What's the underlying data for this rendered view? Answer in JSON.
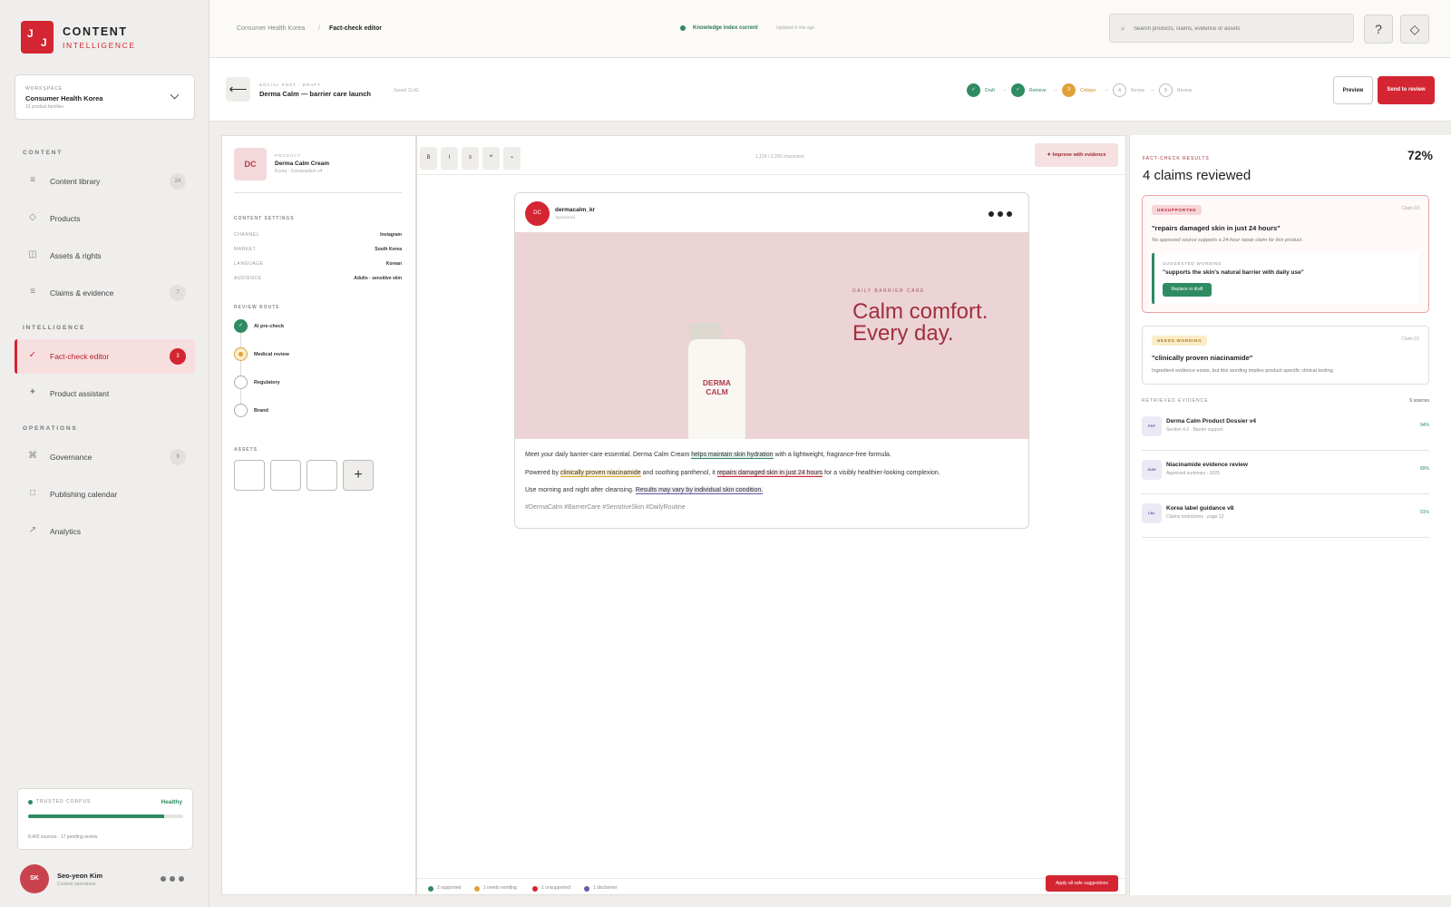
{
  "brand": {
    "mark_left": "J",
    "mark_right": "J",
    "title": "CONTENT",
    "subtitle": "INTELLIGENCE"
  },
  "workspace": {
    "label": "WORKSPACE",
    "name": "Consumer Health Korea",
    "sub": "12 product families"
  },
  "sidebar": {
    "sections": {
      "content": "CONTENT",
      "intelligence": "INTELLIGENCE",
      "operations": "OPERATIONS"
    },
    "items": [
      {
        "label": "Content library",
        "icon": "≡",
        "count": "24"
      },
      {
        "label": "Products",
        "icon": "◇",
        "count": ""
      },
      {
        "label": "Assets & rights",
        "icon": "◫",
        "count": ""
      },
      {
        "label": "Claims & evidence",
        "icon": "≡",
        "count": "7"
      },
      {
        "label": "Fact-check editor",
        "icon": "✓",
        "count": "3"
      },
      {
        "label": "Product assistant",
        "icon": "✦",
        "count": ""
      },
      {
        "label": "Governance",
        "icon": "⌘",
        "count": "9"
      },
      {
        "label": "Publishing calendar",
        "icon": "□",
        "count": ""
      },
      {
        "label": "Analytics",
        "icon": "↗",
        "count": ""
      }
    ]
  },
  "corpus": {
    "label": "TRUSTED CORPUS",
    "status": "Healthy",
    "health": 0.88,
    "sub": "8,402 sources · 17 pending review"
  },
  "user": {
    "initials": "SK",
    "name": "Seo-yeon Kim",
    "role": "Content operations"
  },
  "topbar": {
    "crumb_parent": "Consumer Health Korea",
    "crumb_sep": "/",
    "crumb_current": "Fact-check editor",
    "index_status": "Knowledge index current",
    "index_updated": "Updated 4 min ago",
    "search_placeholder": "Search products, claims, evidence or assets",
    "help_glyph": "?",
    "settings_glyph": "◇"
  },
  "doc": {
    "back_glyph": "⟵",
    "label": "SOCIAL POST · DRAFT",
    "title": "Derma Calm — barrier care launch",
    "saved": "Saved 11:42",
    "steps": [
      {
        "mark": "✓",
        "label": "Draft",
        "state": "done"
      },
      {
        "mark": "✓",
        "label": "Retrieve",
        "state": "done"
      },
      {
        "mark": "3",
        "label": "Critique",
        "state": "current"
      },
      {
        "mark": "4",
        "label": "Revise",
        "state": "todo"
      },
      {
        "mark": "5",
        "label": "Review",
        "state": "todo"
      }
    ],
    "step_arrow": "→",
    "preview": "Preview",
    "send": "Send to review"
  },
  "product": {
    "thumb": "DC",
    "label": "PRODUCT",
    "name": "Derma Calm Cream",
    "sub": "Korea · Composition v4"
  },
  "settings": {
    "heading": "CONTENT SETTINGS",
    "rows": [
      {
        "k": "CHANNEL",
        "v": "Instagram"
      },
      {
        "k": "MARKET",
        "v": "South Korea"
      },
      {
        "k": "LANGUAGE",
        "v": "Korean"
      },
      {
        "k": "AUDIENCE",
        "v": "Adults · sensitive skin"
      }
    ]
  },
  "review_route": {
    "heading": "REVIEW ROUTE",
    "steps": [
      {
        "label": "AI pre-check",
        "state": "done",
        "mark": "✓"
      },
      {
        "label": "Medical review",
        "state": "current",
        "mark": ""
      },
      {
        "label": "Regulatory",
        "state": "todo",
        "mark": ""
      },
      {
        "label": "Brand",
        "state": "todo",
        "mark": ""
      }
    ]
  },
  "assets": {
    "heading": "ASSETS",
    "add_glyph": "+"
  },
  "editor": {
    "tools": [
      "B",
      "I",
      "≡",
      "❝",
      "⌁"
    ],
    "char_count": "1,124 / 2,200 characters",
    "improve": "✦ Improve with evidence"
  },
  "post": {
    "avatar": "DC",
    "username": "dermacalm_kr",
    "sponsored": "Sponsored",
    "hero_eyebrow": "DAILY BARRIER CARE",
    "hero_line1": "Calm comfort.",
    "hero_line2": "Every day.",
    "bottle_line1": "DERMA",
    "bottle_line2": "CALM",
    "l1_a": "Meet your daily barrier-care essential. Derma Calm Cream ",
    "l1_h": "helps maintain skin hydration",
    "l1_b": " with a lightweight, fragrance-free formula.",
    "l2_a": "Powered by ",
    "l2_h1": "clinically proven niacinamide",
    "l2_b": " and soothing panthenol, it ",
    "l2_h2": "repairs damaged skin in just 24 hours",
    "l2_c": " for a visibly healthier-looking complexion.",
    "l3_a": "Use morning and night after cleansing. ",
    "l3_h": "Results may vary by individual skin condition.",
    "tags": "#DermaCalm #BarrierCare #SensitiveSkin #DailyRoutine"
  },
  "legend": {
    "supported": "2 supported",
    "needs": "1 needs wording",
    "unsupported": "1 unsupported",
    "disclaimer": "1 disclaimer",
    "apply": "Apply all safe suggestions"
  },
  "results": {
    "label": "FACT-CHECK RESULTS",
    "title": "4 claims reviewed",
    "score": "72%",
    "claims": [
      {
        "badge": "UNSUPPORTED",
        "num": "Claim 03",
        "quote": "\"repairs damaged skin in just 24 hours\"",
        "desc": "No approved source supports a 24-hour repair claim for this product.",
        "sugg_label": "SUGGESTED WORDING",
        "sugg_quote": "\"supports the skin's natural barrier with daily use\"",
        "sugg_btn": "Replace in draft"
      },
      {
        "badge": "NEEDS WORDING",
        "num": "Claim 02",
        "quote": "\"clinically proven niacinamide\"",
        "desc": "Ingredient evidence exists, but this wording implies product-specific clinical testing."
      }
    ],
    "evidence_heading": "RETRIEVED EVIDENCE",
    "evidence_count": "6 sources",
    "evidence": [
      {
        "icon": "PDF",
        "name": "Derma Calm Product Dossier v4",
        "sub": "Section 4.2 · Barrier support",
        "pct": "94%"
      },
      {
        "icon": "SUM",
        "name": "Niacinamide evidence review",
        "sub": "Approved summary · 2025",
        "pct": "89%"
      },
      {
        "icon": "LBL",
        "name": "Korea label guidance v8",
        "sub": "Claims restrictions · page 12",
        "pct": "91%"
      }
    ]
  },
  "colors": {
    "accent": "#d42532",
    "supported": "#2e8b62",
    "needs": "#e0a13a",
    "disclaimer": "#6a5ba0"
  }
}
